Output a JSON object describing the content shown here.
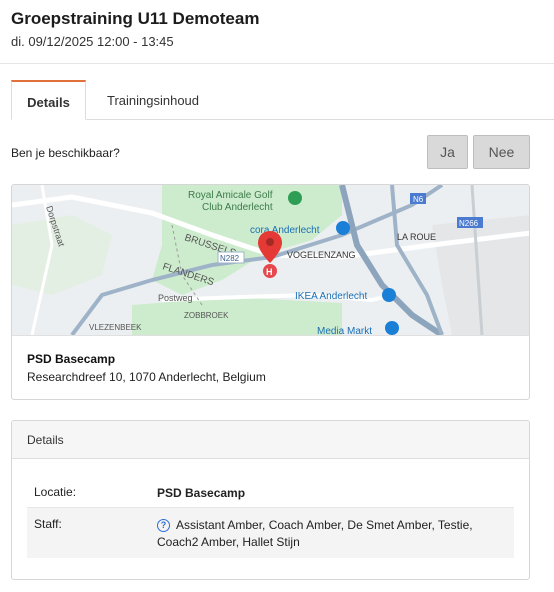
{
  "header": {
    "title": "Groepstraining U11 Demoteam",
    "datetime": "di. 09/12/2025 12:00 - 13:45"
  },
  "tabs": [
    {
      "label": "Details",
      "active": true
    },
    {
      "label": "Trainingsinhoud",
      "active": false
    }
  ],
  "availability": {
    "question": "Ben je beschikbaar?",
    "yes_label": "Ja",
    "no_label": "Nee"
  },
  "map": {
    "labels": {
      "royal": "Royal Amicale Golf",
      "club": "Club Anderlecht",
      "cora": "cora Anderlecht",
      "brussels": "BRUSSELS",
      "flanders": "FLANDERS",
      "vogelenzang": "VOGELENZANG",
      "la_roue": "LA ROUE",
      "ikea": "IKEA Anderlecht",
      "media": "Media Markt",
      "postweg": "Postweg",
      "vlezenbeek": "VLEZENBEEK",
      "zobbroek": "ZOBBROEK",
      "dorp": "Dorpstraat",
      "n282": "N282",
      "n266": "N266",
      "n6": "N6"
    },
    "marker_icon": "map-pin-icon",
    "hospital_icon": "hospital-icon"
  },
  "location": {
    "name": "PSD Basecamp",
    "address": "Researchdreef 10, 1070 Anderlecht, Belgium"
  },
  "details": {
    "heading": "Details",
    "rows": [
      {
        "key": "Locatie:",
        "value": "PSD Basecamp"
      },
      {
        "key": "Staff:",
        "value": "Assistant Amber, Coach Amber, De Smet Amber, Testie, Coach2 Amber, Hallet Stijn"
      }
    ],
    "info_icon": "question-icon"
  },
  "colors": {
    "accent": "#e2703a",
    "button_bg": "#d9d9d9",
    "marker": "#e53935",
    "map_green": "#cdeccd",
    "map_road": "#9fb3c8"
  }
}
